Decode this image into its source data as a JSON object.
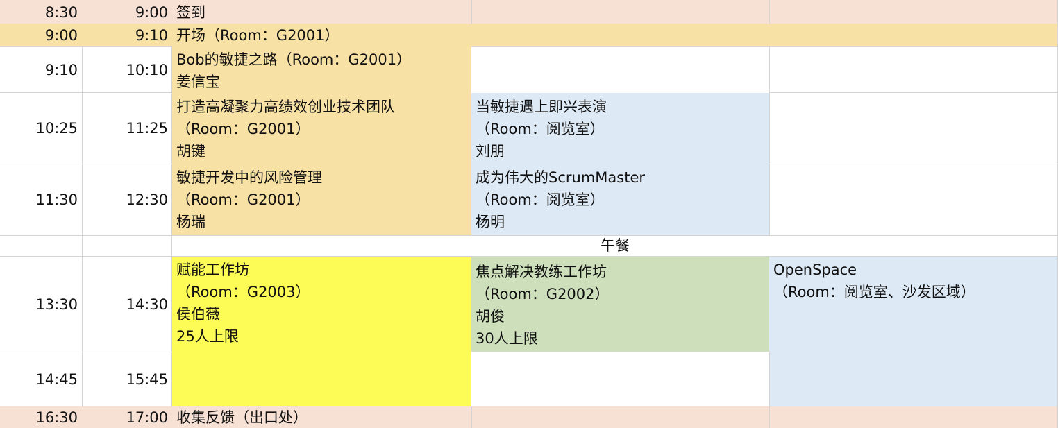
{
  "colors": {
    "pink": "#f7e1d5",
    "orange": "#f8e1a5",
    "blue": "#dde9f5",
    "yellow": "#fdfb55",
    "green": "#cddfbb",
    "grid": "#d4d4d4"
  },
  "rows": {
    "r1": {
      "start": "8:30",
      "end": "9:00",
      "title": "签到"
    },
    "r2": {
      "start": "9:00",
      "end": "9:10",
      "title": "开场（Room：G2001）"
    },
    "r3": {
      "start": "9:10",
      "end": "10:10",
      "session_a": {
        "title": "Bob的敏捷之路（Room：G2001）",
        "speaker": "姜信宝"
      }
    },
    "r4": {
      "start": "10:25",
      "end": "11:25",
      "session_a": {
        "title": "打造高凝聚力高绩效创业技术团队",
        "room": "（Room：G2001）",
        "speaker": "胡键"
      },
      "session_b": {
        "title": "当敏捷遇上即兴表演",
        "room": "（Room：阅览室）",
        "speaker": "刘朋"
      }
    },
    "r5": {
      "start": "11:30",
      "end": "12:30",
      "session_a": {
        "title": "敏捷开发中的风险管理",
        "room": "（Room：G2001）",
        "speaker": "杨瑞"
      },
      "session_b": {
        "title": "成为伟大的ScrumMaster",
        "room": "（Room：阅览室）",
        "speaker": "杨明"
      }
    },
    "lunch": {
      "title": "午餐"
    },
    "r6": {
      "start": "13:30",
      "end": "14:30",
      "session_a": {
        "title": "赋能工作坊",
        "room": "（Room：G2003）",
        "speaker": "侯伯薇",
        "limit": "25人上限"
      },
      "session_b": {
        "title": "焦点解决教练工作坊",
        "room": "（Room：G2002）",
        "speaker": "胡俊",
        "limit": "30人上限"
      },
      "session_c": {
        "title": "OpenSpace",
        "room": "（Room：阅览室、沙发区域）"
      }
    },
    "r7": {
      "start": "14:45",
      "end": "15:45"
    },
    "r8": {
      "start": "16:30",
      "end": "17:00",
      "title": "收集反馈（出口处）"
    }
  }
}
